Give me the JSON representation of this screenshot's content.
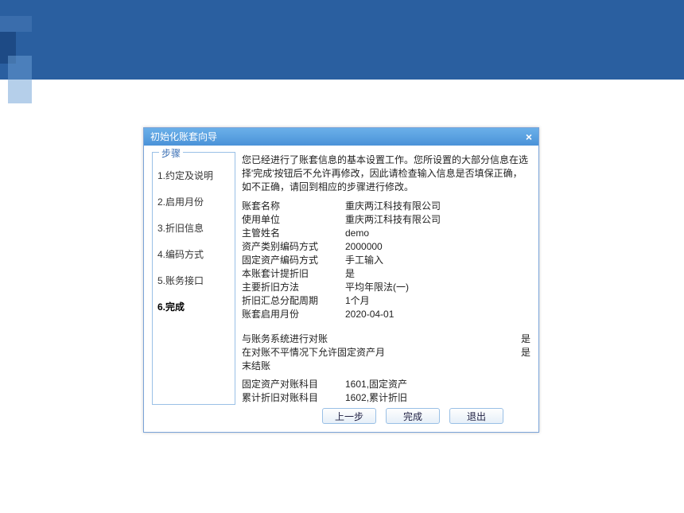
{
  "dialog": {
    "title": "初始化账套向导",
    "close_label": "×"
  },
  "sidebar": {
    "legend": "步骤",
    "items": [
      {
        "label": "1.约定及说明"
      },
      {
        "label": "2.启用月份"
      },
      {
        "label": "3.折旧信息"
      },
      {
        "label": "4.编码方式"
      },
      {
        "label": "5.账务接口"
      },
      {
        "label": "6.完成",
        "active": true
      }
    ]
  },
  "content": {
    "intro": "您已经进行了账套信息的基本设置工作。您所设置的大部分信息在选择'完成'按钮后不允许再修改，因此请检查输入信息是否填保正确，如不正确，请回到相应的步骤进行修改。",
    "rows": [
      {
        "label": "账套名称",
        "value": "重庆两江科技有限公司"
      },
      {
        "label": "使用单位",
        "value": "重庆两江科技有限公司"
      },
      {
        "label": "主管姓名",
        "value": "demo"
      },
      {
        "label": "资产类别编码方式",
        "value": "2000000"
      },
      {
        "label": "固定资产编码方式",
        "value": "手工输入"
      },
      {
        "label": "本账套计提折旧",
        "value": "是"
      },
      {
        "label": "主要折旧方法",
        "value": "平均年限法(一)"
      },
      {
        "label": "折旧汇总分配周期",
        "value": " 1个月"
      },
      {
        "label": "账套启用月份",
        "value": "2020-04-01"
      }
    ],
    "rows2": [
      {
        "label": "与账务系统进行对账",
        "value": "是"
      },
      {
        "label": "在对账不平情况下允许固定资产月末结账",
        "value": "是"
      }
    ],
    "rows3": [
      {
        "label": "固定资产对账科目",
        "value": "1601,固定资产"
      },
      {
        "label": "累计折旧对账科目",
        "value": "1602,累计折旧"
      }
    ]
  },
  "buttons": {
    "prev": "上一步",
    "finish": "完成",
    "exit": "退出"
  }
}
